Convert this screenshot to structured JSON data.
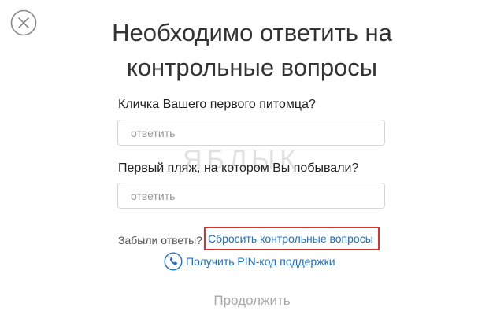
{
  "title": {
    "line1": "Необходимо ответить на",
    "line2": "контрольные вопросы"
  },
  "questions": [
    {
      "label": "Кличка Вашего первого питомца?",
      "placeholder": "ответить",
      "value": ""
    },
    {
      "label": "Первый пляж, на котором Вы побывали?",
      "placeholder": "ответить",
      "value": ""
    }
  ],
  "watermark": "ЯБЛЫК",
  "forgot": {
    "text": "Забыли ответы?",
    "reset_link": "Сбросить контрольные вопросы"
  },
  "pin": {
    "label": "Получить PIN-код поддержки",
    "icon": "phone-icon"
  },
  "continue_label": "Продолжить",
  "colors": {
    "link": "#1a6fc7",
    "highlight_border": "#d8312f",
    "disabled_text": "#a8a8a8"
  }
}
